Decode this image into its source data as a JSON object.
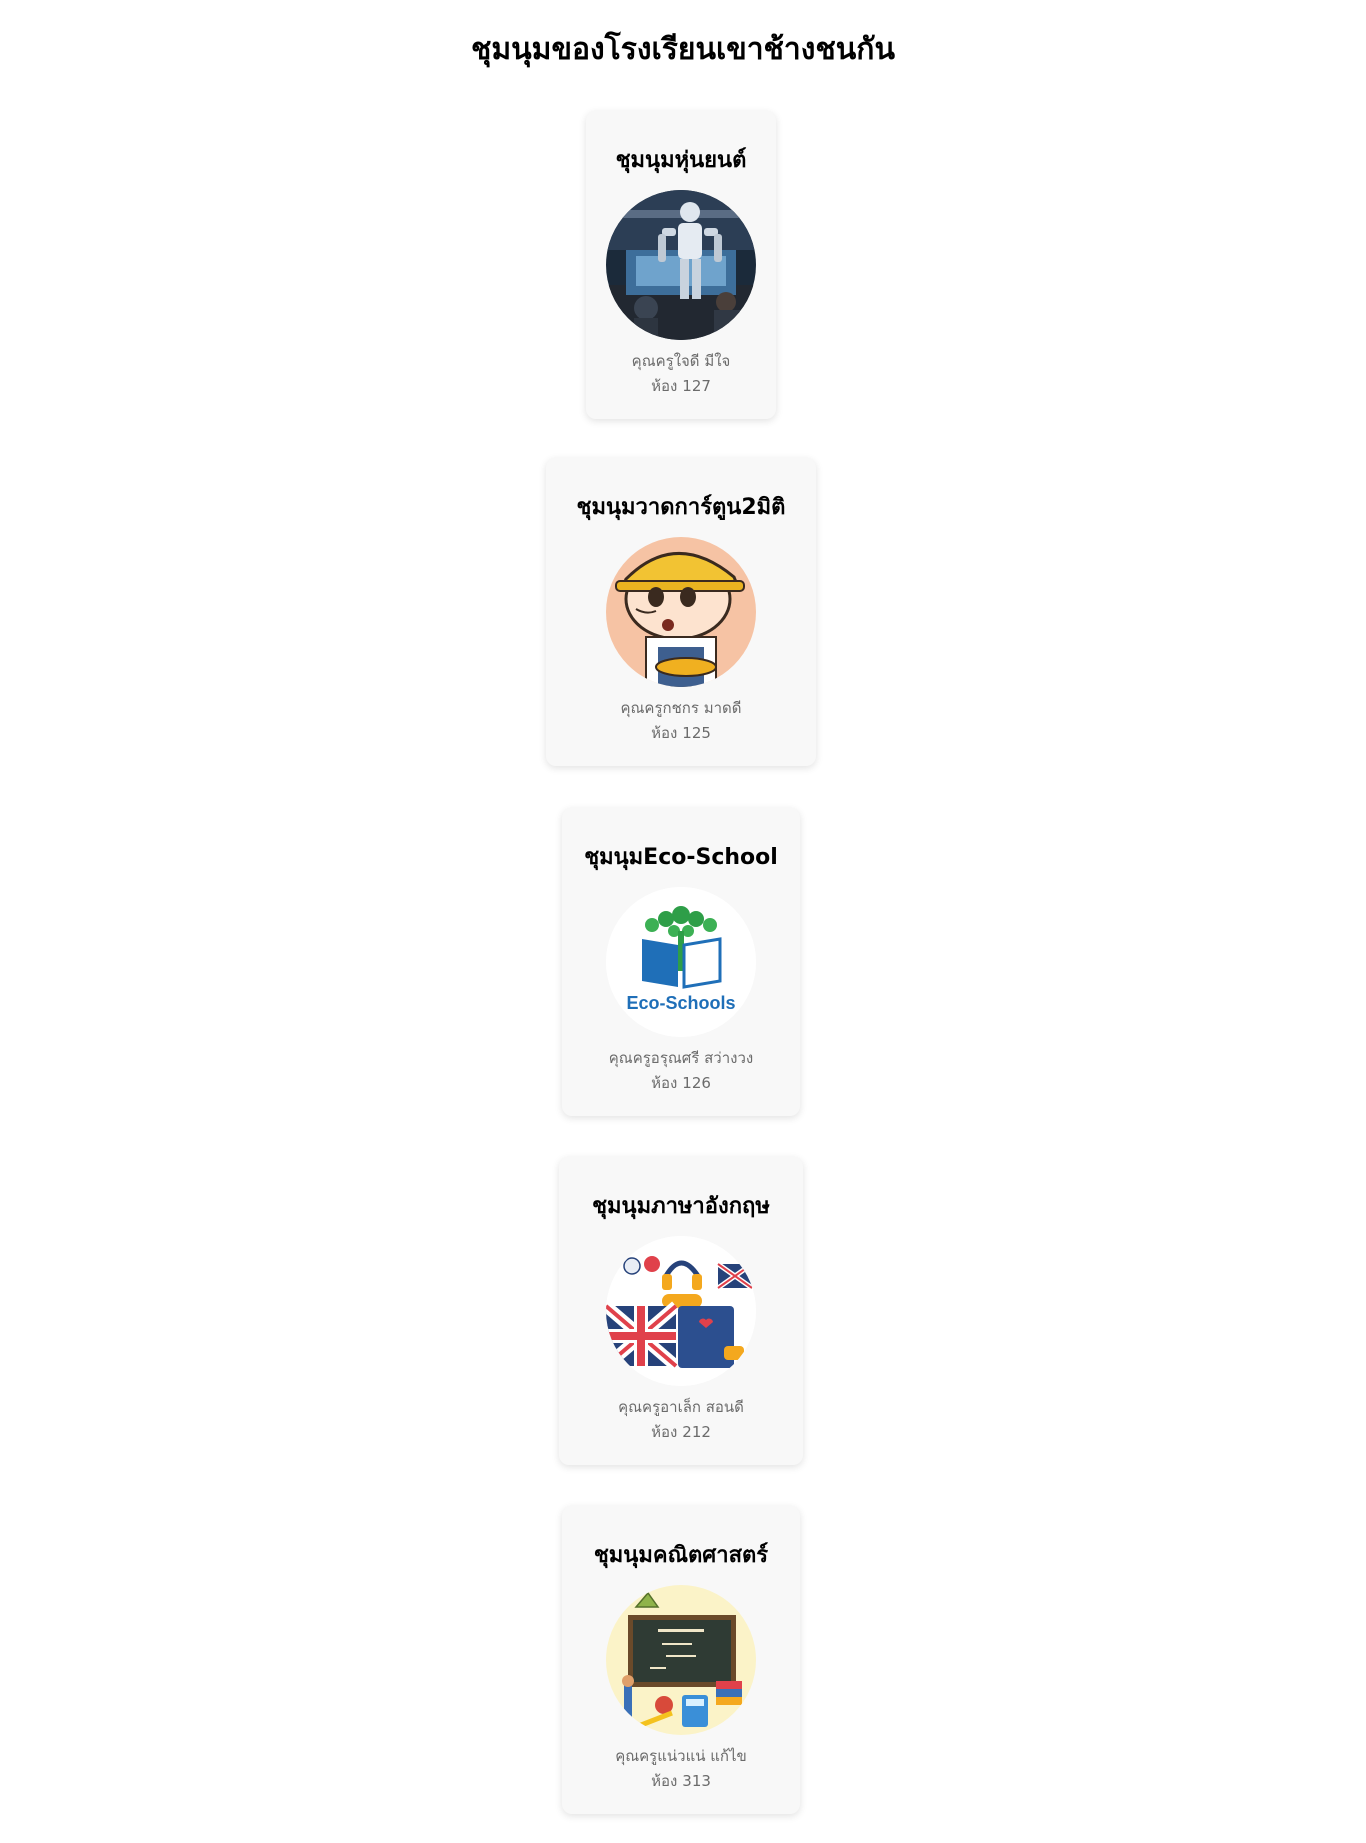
{
  "page": {
    "title": "ชุมนุมของโรงเรียนเขาช้างชนกัน"
  },
  "room_label": "ห้อง",
  "clubs": [
    {
      "name": "ชุมนุมหุ่นยนต์",
      "teacher": "คุณครูใจดี มีใจ",
      "room": "127",
      "image_icon": "robot-photo"
    },
    {
      "name": "ชุมนุมวาดการ์ตูน2มิติ",
      "teacher": "คุณครูกชกร มาดดี",
      "room": "125",
      "image_icon": "cartoon-boy-hardhat-illustration"
    },
    {
      "name": "ชุมนุมEco-School",
      "teacher": "คุณครูอรุณศรี สว่างวง",
      "room": "126",
      "image_icon": "eco-schools-logo",
      "image_text": "Eco-Schools"
    },
    {
      "name": "ชุมนุมภาษาอังกฤษ",
      "teacher": "คุณครูอาเล็ก สอนดี",
      "room": "212",
      "image_icon": "english-learning-illustration"
    },
    {
      "name": "ชุมนุมคณิตศาสตร์",
      "teacher": "คุณครูแน่วแน่ แก้ไข",
      "room": "313",
      "image_icon": "maths-blackboard-illustration"
    }
  ],
  "colors": {
    "card_background": "#f8f8f8",
    "secondary_text": "#6b6b6b",
    "eco_green": "#2e9e48",
    "eco_blue": "#1f6fb8"
  }
}
